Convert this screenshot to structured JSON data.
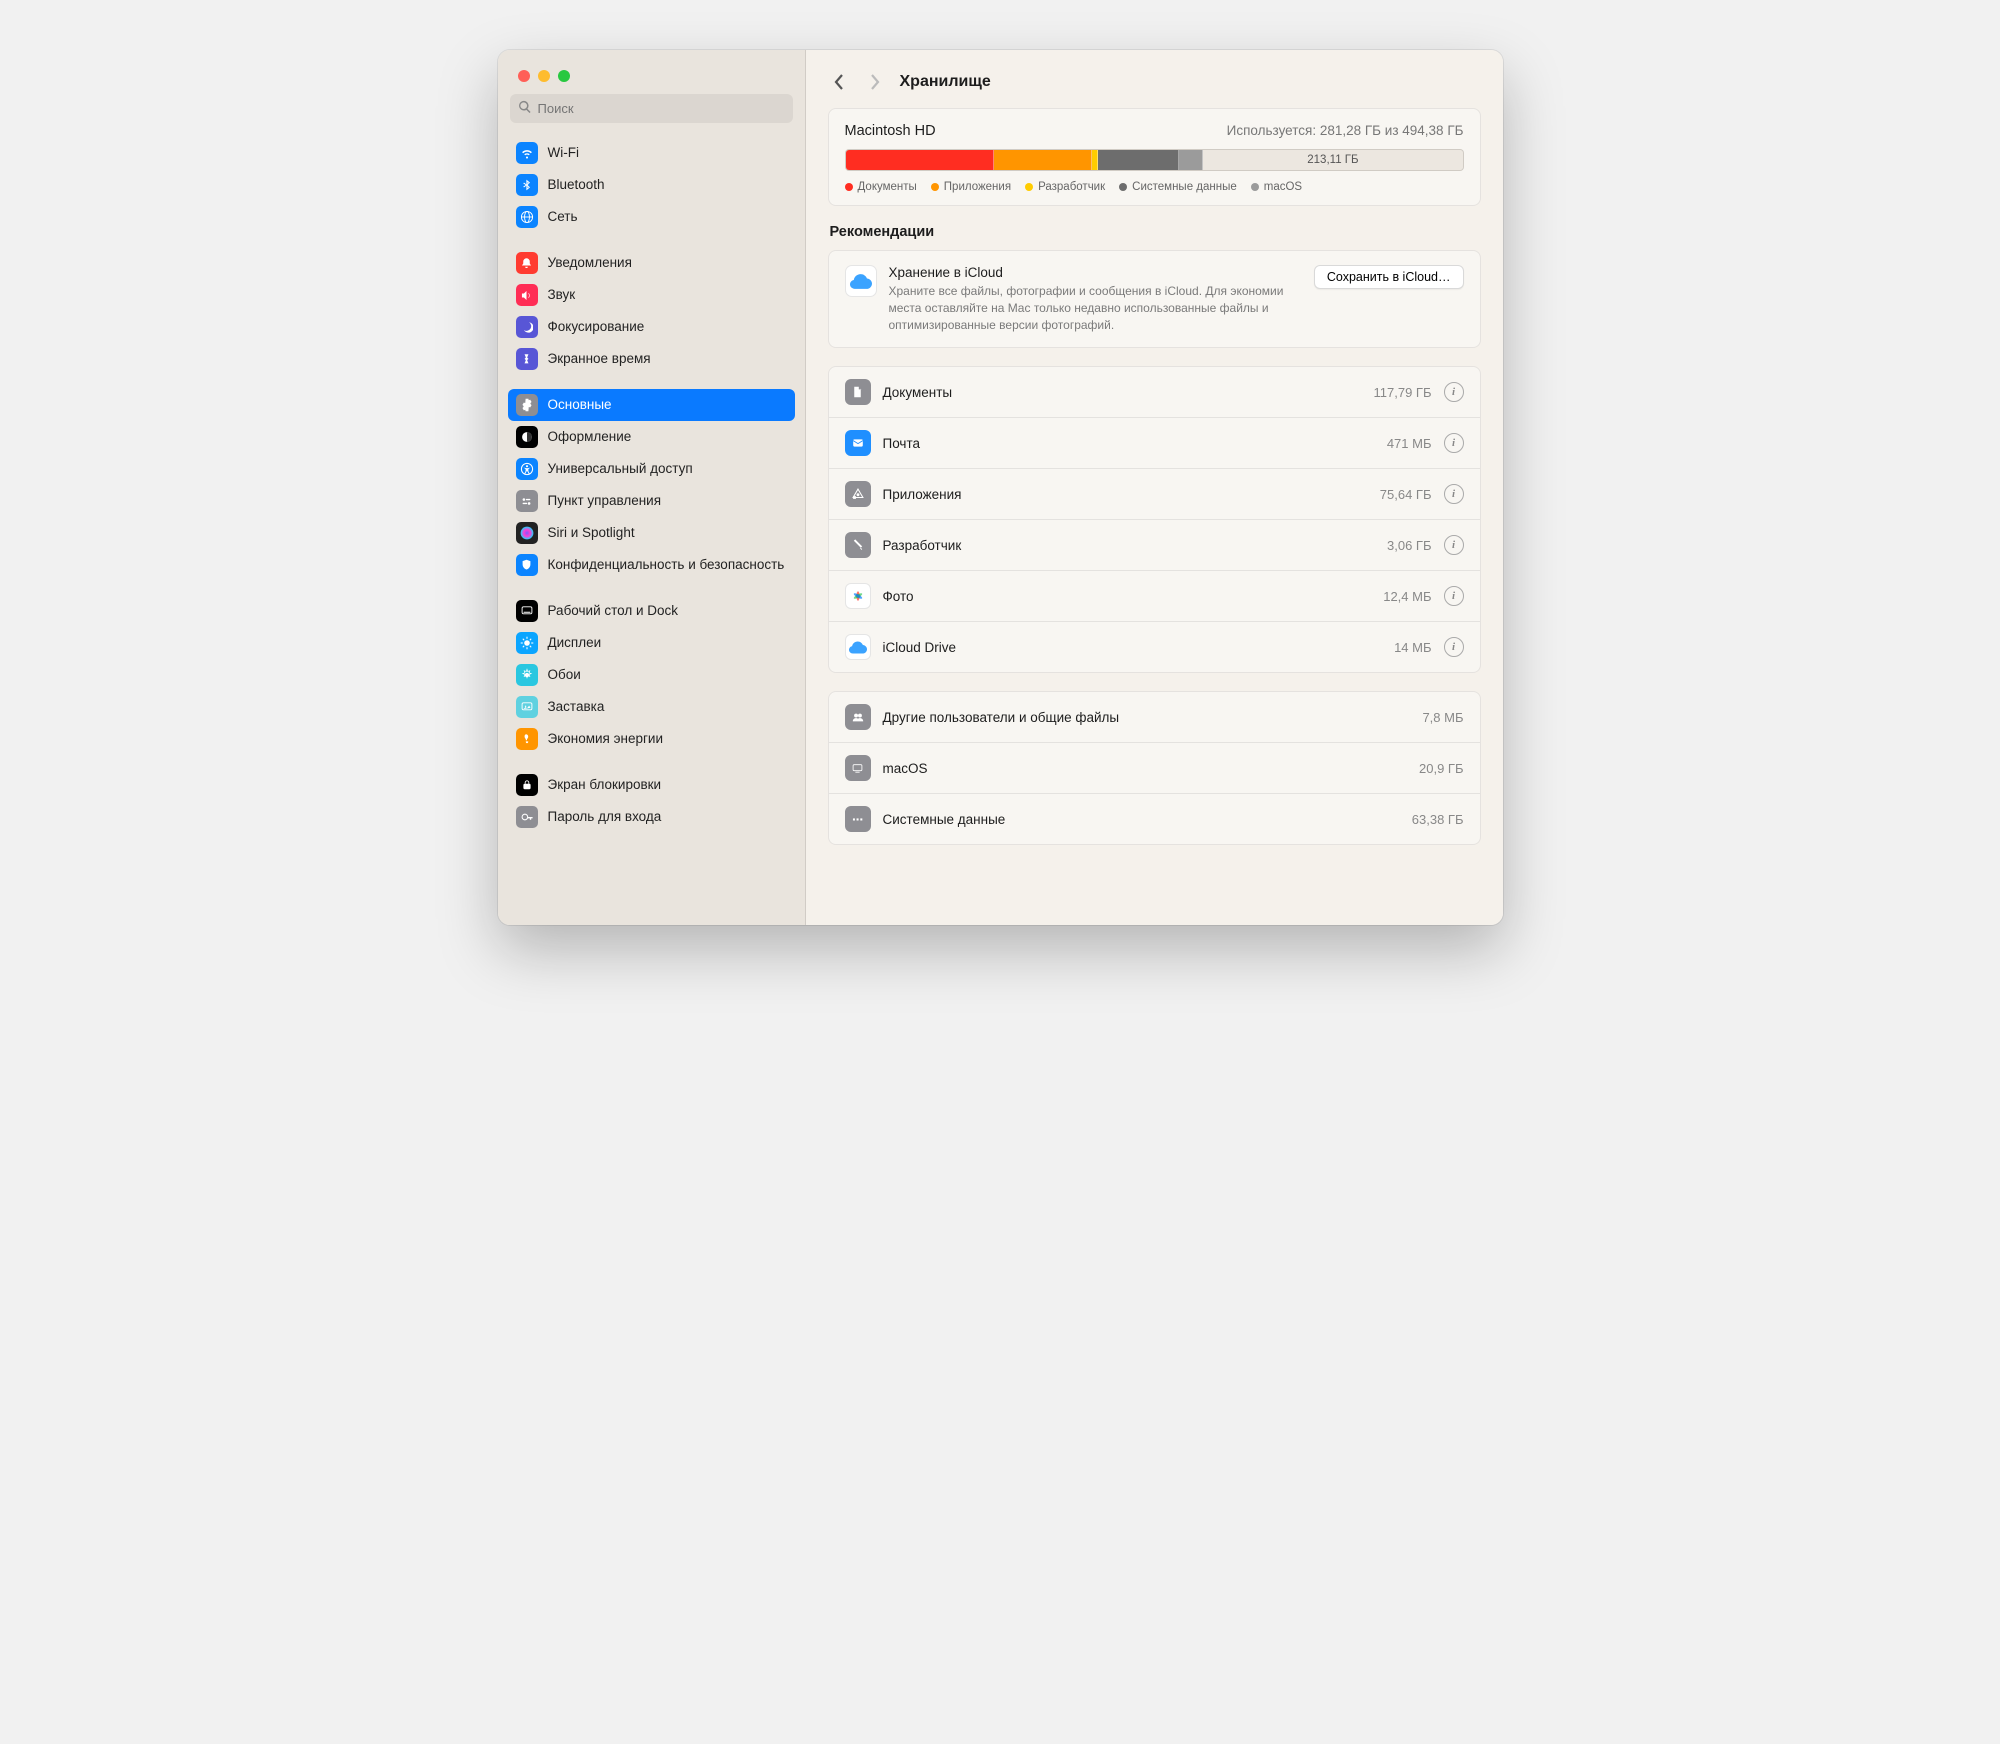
{
  "header": {
    "title": "Хранилище"
  },
  "search": {
    "placeholder": "Поиск"
  },
  "sidebar": {
    "items": [
      {
        "label": "Wi-Fi",
        "icon": "wifi",
        "bg": "#0b84ff"
      },
      {
        "label": "Bluetooth",
        "icon": "bluetooth",
        "bg": "#0b84ff"
      },
      {
        "label": "Сеть",
        "icon": "network",
        "bg": "#0b84ff"
      },
      {
        "spacer": true
      },
      {
        "label": "Уведомления",
        "icon": "bell",
        "bg": "#ff3b30"
      },
      {
        "label": "Звук",
        "icon": "sound",
        "bg": "#ff2d55"
      },
      {
        "label": "Фокусирование",
        "icon": "focus",
        "bg": "#5856d6"
      },
      {
        "label": "Экранное время",
        "icon": "screentime",
        "bg": "#5856d6"
      },
      {
        "spacer": true
      },
      {
        "label": "Основные",
        "icon": "gear",
        "bg": "#8e8e93",
        "selected": true
      },
      {
        "label": "Оформление",
        "icon": "appearance",
        "bg": "#000000"
      },
      {
        "label": "Универсальный доступ",
        "icon": "accessibility",
        "bg": "#0b84ff"
      },
      {
        "label": "Пункт управления",
        "icon": "controlcenter",
        "bg": "#8e8e93"
      },
      {
        "label": "Siri и Spotlight",
        "icon": "siri",
        "bg": "#222"
      },
      {
        "label": "Конфиденциальность и безопасность",
        "icon": "privacy",
        "bg": "#0b84ff"
      },
      {
        "spacer": true
      },
      {
        "label": "Рабочий стол и Dock",
        "icon": "dock",
        "bg": "#000000"
      },
      {
        "label": "Дисплеи",
        "icon": "displays",
        "bg": "#0ba5ff"
      },
      {
        "label": "Обои",
        "icon": "wallpaper",
        "bg": "#2ac7e0"
      },
      {
        "label": "Заставка",
        "icon": "screensaver",
        "bg": "#5fd1e0"
      },
      {
        "label": "Экономия энергии",
        "icon": "energy",
        "bg": "#ff9500"
      },
      {
        "spacer": true
      },
      {
        "label": "Экран блокировки",
        "icon": "lockscreen",
        "bg": "#000000"
      },
      {
        "label": "Пароль для входа",
        "icon": "password",
        "bg": "#8e8e93"
      }
    ]
  },
  "disk": {
    "name": "Macintosh HD",
    "usage_text": "Используется: 281,28 ГБ из 494,38 ГБ",
    "free_label": "213,11 ГБ",
    "segments": [
      {
        "label": "Документы",
        "color": "#ff2d21",
        "pct": 24
      },
      {
        "label": "Приложения",
        "color": "#ff9500",
        "pct": 16
      },
      {
        "label": "Разработчик",
        "color": "#ffcc00",
        "pct": 1
      },
      {
        "label": "Системные данные",
        "color": "#6d6d6d",
        "pct": 13
      },
      {
        "label": "macOS",
        "color": "#9b9b9b",
        "pct": 4
      }
    ]
  },
  "recommendations": {
    "section_title": "Рекомендации",
    "title": "Хранение в iCloud",
    "desc": "Храните все файлы, фотографии и сообщения в iCloud. Для экономии места оставляйте на Mac только недавно использованные файлы и оптимизированные версии фотографий.",
    "button": "Сохранить в iCloud…"
  },
  "categories_top": [
    {
      "label": "Документы",
      "size": "117,79 ГБ",
      "icon": "doc",
      "bg": "#8e8e93",
      "info": true
    },
    {
      "label": "Почта",
      "size": "471 МБ",
      "icon": "mail",
      "bg": "#1f8fff",
      "info": true
    },
    {
      "label": "Приложения",
      "size": "75,64 ГБ",
      "icon": "apps",
      "bg": "#8e8e93",
      "info": true
    },
    {
      "label": "Разработчик",
      "size": "3,06 ГБ",
      "icon": "dev",
      "bg": "#8e8e93",
      "info": true
    },
    {
      "label": "Фото",
      "size": "12,4 МБ",
      "icon": "photos",
      "bg": "#ffffff",
      "info": true
    },
    {
      "label": "iCloud Drive",
      "size": "14 МБ",
      "icon": "icloud",
      "bg": "#ffffff",
      "info": true
    }
  ],
  "categories_bottom": [
    {
      "label": "Другие пользователи и общие файлы",
      "size": "7,8 МБ",
      "icon": "users",
      "bg": "#8e8e93",
      "info": false
    },
    {
      "label": "macOS",
      "size": "20,9 ГБ",
      "icon": "macos",
      "bg": "#8e8e93",
      "info": false
    },
    {
      "label": "Системные данные",
      "size": "63,38 ГБ",
      "icon": "sysdata",
      "bg": "#8e8e93",
      "info": false
    }
  ]
}
